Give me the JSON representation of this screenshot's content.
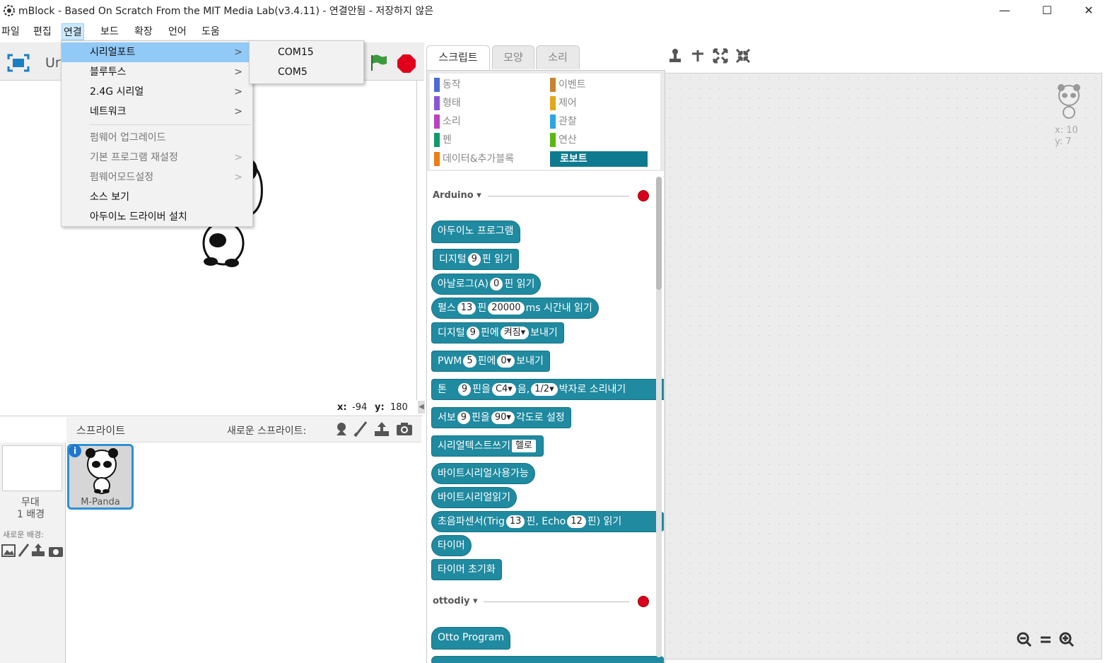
{
  "window": {
    "title": "mBlock - Based On Scratch From the MIT Media Lab(v3.4.11) - 연결안됨 - 저장하지 않은",
    "minimize": "—",
    "maximize": "☐",
    "close": "✕"
  },
  "menubar": {
    "items": [
      "파일",
      "편집",
      "연결",
      "보드",
      "확장",
      "언어",
      "도움"
    ]
  },
  "connect_menu": {
    "items": [
      {
        "label": "시리얼포트",
        "submenu": true
      },
      {
        "label": "블루투스",
        "submenu": true
      },
      {
        "label": "2.4G 시리얼",
        "submenu": true
      },
      {
        "label": "네트워크",
        "submenu": true
      },
      {
        "label": "펌웨어 업그레이드",
        "disabled": true
      },
      {
        "label": "기본 프로그램 재설정",
        "disabled": true,
        "submenu": true
      },
      {
        "label": "펌웨어모드설정",
        "disabled": true,
        "submenu": true
      },
      {
        "label": "소스 보기"
      },
      {
        "label": "아두이노 드라이버 설치"
      }
    ],
    "arrow": ">"
  },
  "serial_submenu": {
    "items": [
      "COM15",
      "COM5"
    ]
  },
  "stage": {
    "project_title_partial": "Ur",
    "x_label": "x:",
    "x_value": "-94",
    "y_label": "y:",
    "y_value": "180"
  },
  "sprites": {
    "header": "스프라이트",
    "new_sprite_label": "새로운 스프라이트:",
    "stage_label": "무대",
    "backdrop_count": "1 배경",
    "new_backdrop_label": "새로운 배경:",
    "sprite_name": "M-Panda",
    "info_badge": "i"
  },
  "tabs": [
    "스크립트",
    "모양",
    "소리"
  ],
  "categories": {
    "left": [
      {
        "label": "동작",
        "color": "#4a6cd4"
      },
      {
        "label": "형태",
        "color": "#8a55d7"
      },
      {
        "label": "소리",
        "color": "#bb42c3"
      },
      {
        "label": "펜",
        "color": "#0e9a6c"
      },
      {
        "label": "데이터&추가블록",
        "color": "#ee7d16"
      }
    ],
    "right": [
      {
        "label": "이벤트",
        "color": "#c88330"
      },
      {
        "label": "제어",
        "color": "#e1a91a"
      },
      {
        "label": "관찰",
        "color": "#2ca5e2"
      },
      {
        "label": "연산",
        "color": "#5cb712"
      },
      {
        "label": "로보트",
        "color": "#0e7a8f",
        "active": true
      }
    ]
  },
  "sections": {
    "arduino": "Arduino",
    "ottodiy": "ottodiy"
  },
  "blocks": {
    "arduino_program": "아두이노 프로그램",
    "digital_read": [
      "디지털",
      "9",
      "핀 읽기"
    ],
    "analog_read": [
      "아날로그(A)",
      "0",
      "핀 읽기"
    ],
    "pulse_read": [
      "펄스",
      "13",
      "핀",
      "20000",
      "ms 시간내 읽기"
    ],
    "digital_write": [
      "디지털",
      "9",
      "핀에",
      "켜짐▾",
      "보내기"
    ],
    "pwm_write": [
      "PWM",
      "5",
      "핀에",
      "0▾",
      "보내기"
    ],
    "tone": [
      "톤",
      "9",
      "핀을",
      "C4▾",
      "음,",
      "1/2▾",
      "박자로 소리내기"
    ],
    "servo": [
      "서보",
      "9",
      "핀을",
      "90▾",
      "각도로 설정"
    ],
    "serial_write": [
      "시리얼텍스트쓰기",
      "헬로"
    ],
    "byte_serial_available": "바이트시리얼사용가능",
    "byte_serial_read": "바이트시리얼읽기",
    "ultrasonic": [
      "초음파센서(Trig",
      "13",
      "핀, Echo",
      "12",
      "핀) 읽기"
    ],
    "timer": "타이머",
    "timer_reset": "타이머 초기화",
    "otto_program": "Otto Program"
  },
  "script_area": {
    "sprite_x": "x: 10",
    "sprite_y": "y: 7"
  }
}
